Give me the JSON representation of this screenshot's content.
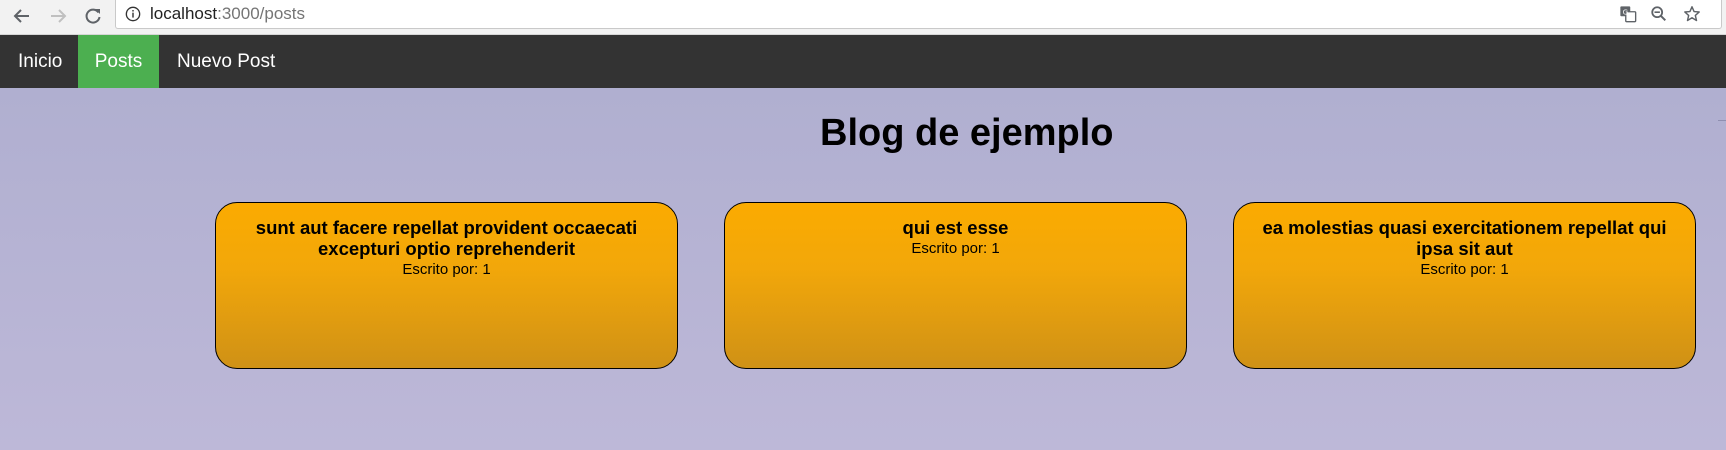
{
  "browser": {
    "url_host": "localhost",
    "url_path": ":3000/posts"
  },
  "navbar": {
    "items": [
      {
        "label": "Inicio",
        "active": false
      },
      {
        "label": "Posts",
        "active": true
      },
      {
        "label": "Nuevo Post",
        "active": false
      }
    ]
  },
  "page": {
    "title": "Blog de ejemplo"
  },
  "posts": [
    {
      "title": "sunt aut facere repellat provident occaecati excepturi optio reprehenderit",
      "author": "Escrito por: 1"
    },
    {
      "title": "qui est esse",
      "author": "Escrito por: 1"
    },
    {
      "title": "ea molestias quasi exercitationem repellat qui ipsa sit aut",
      "author": "Escrito por: 1"
    }
  ],
  "colors": {
    "navbar_bg": "#333333",
    "nav_active": "#4caf50",
    "card_orange": "#fbab00",
    "page_bg": "#b6b3d5"
  },
  "icons": [
    "back-arrow-icon",
    "forward-arrow-icon",
    "reload-icon",
    "info-icon",
    "translate-icon",
    "zoom-out-icon",
    "star-icon"
  ]
}
